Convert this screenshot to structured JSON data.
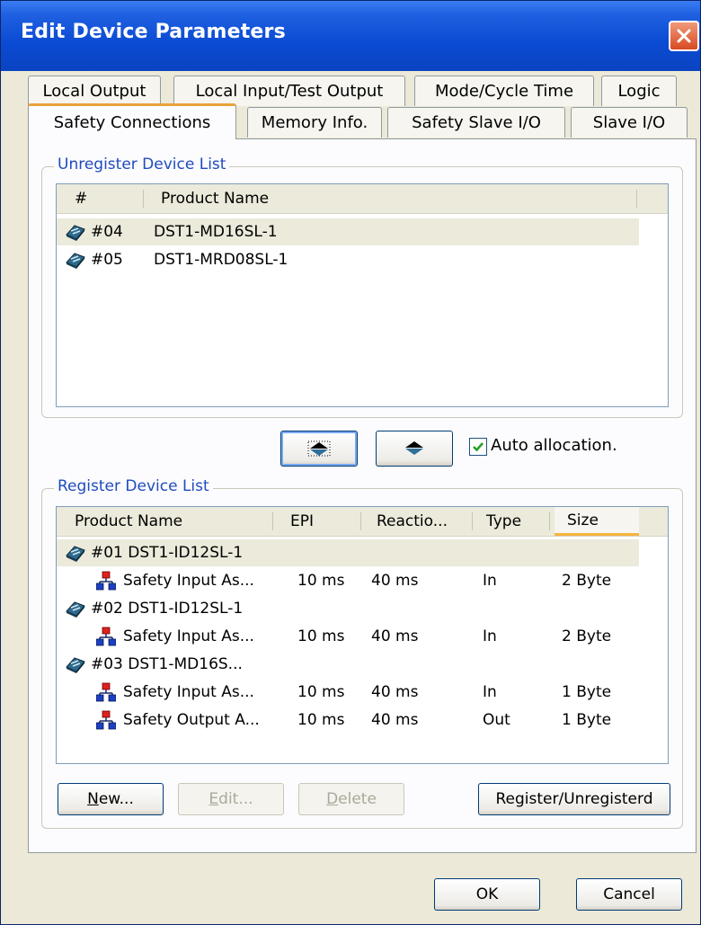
{
  "window": {
    "title": "Edit Device Parameters"
  },
  "tabs_row1": [
    {
      "label": "Local Output"
    },
    {
      "label": "Local Input/Test Output"
    },
    {
      "label": "Mode/Cycle Time"
    },
    {
      "label": "Logic"
    }
  ],
  "tabs_row2": [
    {
      "label": "Safety Connections",
      "active": true
    },
    {
      "label": "Memory Info."
    },
    {
      "label": "Safety Slave I/O"
    },
    {
      "label": "Slave I/O"
    }
  ],
  "unregister": {
    "title": "Unregister Device List",
    "columns": {
      "num": "#",
      "product": "Product Name"
    },
    "rows": [
      {
        "num": "#04",
        "product": "DST1-MD16SL-1",
        "selected": true
      },
      {
        "num": "#05",
        "product": "DST1-MRD08SL-1",
        "selected": false
      }
    ]
  },
  "auto_allocation": {
    "label": "Auto allocation.",
    "checked": true
  },
  "register": {
    "title": "Register Device List",
    "columns": {
      "product": "Product Name",
      "epi": "EPI",
      "reaction": "Reactio...",
      "type": "Type",
      "size": "Size"
    },
    "devices": [
      {
        "label": "#01 DST1-ID12SL-1",
        "selected": true,
        "connections": [
          {
            "name": "Safety Input As...",
            "epi": "10 ms",
            "reaction": "40 ms",
            "type": "In",
            "size": "2 Byte"
          }
        ]
      },
      {
        "label": "#02 DST1-ID12SL-1",
        "connections": [
          {
            "name": "Safety Input As...",
            "epi": "10 ms",
            "reaction": "40 ms",
            "type": "In",
            "size": "2 Byte"
          }
        ]
      },
      {
        "label": "#03 DST1-MD16S...",
        "connections": [
          {
            "name": "Safety Input As...",
            "epi": "10 ms",
            "reaction": "40 ms",
            "type": "In",
            "size": "1 Byte"
          },
          {
            "name": "Safety Output A...",
            "epi": "10 ms",
            "reaction": "40 ms",
            "type": "Out",
            "size": "1 Byte"
          }
        ]
      }
    ]
  },
  "buttons": {
    "new_first": "N",
    "new_rest": "ew...",
    "edit_first": "E",
    "edit_rest": "dit...",
    "delete_first": "D",
    "delete_rest": "elete",
    "register": "Register/Unregisterd",
    "ok": "OK",
    "cancel": "Cancel"
  },
  "icons": {
    "device": "device-icon",
    "connection": "connection-icon",
    "move_up": "arrow-up-icon",
    "move_down": "arrow-down-icon",
    "close": "close-icon",
    "check": "check-icon"
  },
  "colors": {
    "titlebar": "#0b4bd3",
    "active_tab_accent": "#e8a33d",
    "group_title": "#1f4bbd",
    "close_button": "#d84a22",
    "selected_row": "#ebeadb"
  }
}
